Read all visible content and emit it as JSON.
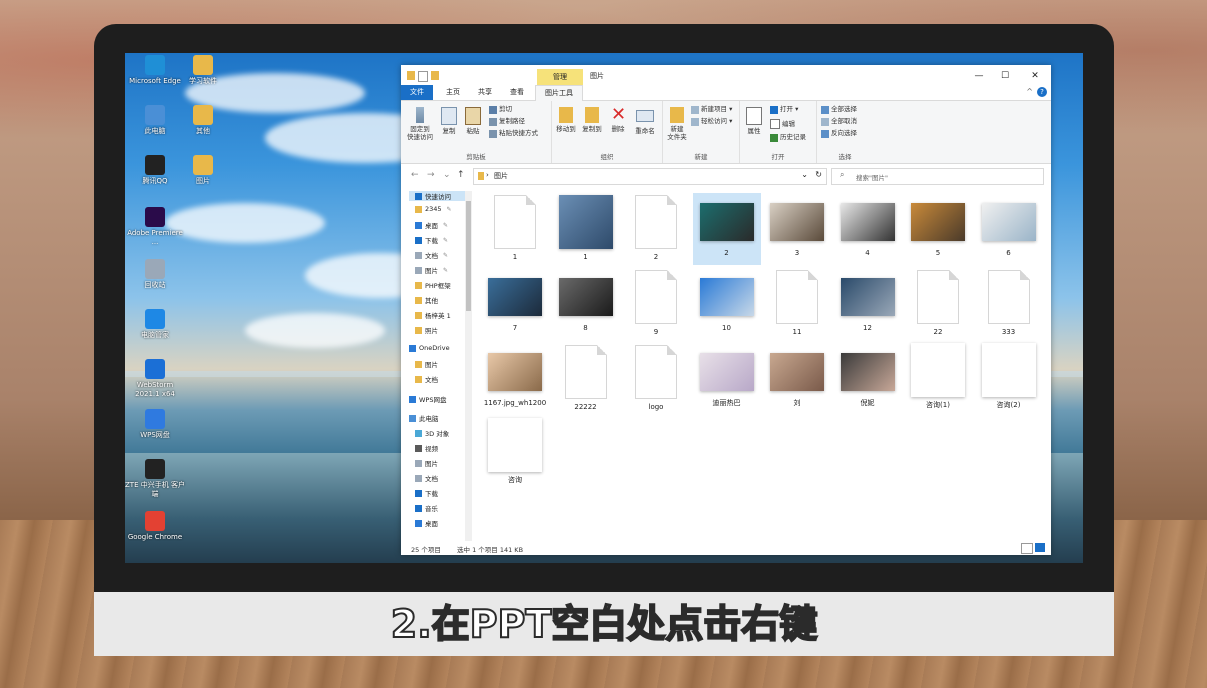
{
  "desktop": {
    "icons": [
      {
        "label": "Microsoft Edge",
        "color": "#1f8fd6"
      },
      {
        "label": "学习软件",
        "color": "#e8b84a"
      },
      {
        "label": "此电脑",
        "color": "#4a8fd6"
      },
      {
        "label": "其他",
        "color": "#e8b84a"
      },
      {
        "label": "腾讯QQ",
        "color": "#222222"
      },
      {
        "label": "图片",
        "color": "#e8b84a"
      },
      {
        "label": "Adobe Premiere ...",
        "color": "#2a0b4a"
      },
      {
        "label": "回收站",
        "color": "#9aa8b8"
      },
      {
        "label": "电脑管家",
        "color": "#1e88e5"
      },
      {
        "label": "WebStorm 2021.1 x64",
        "color": "#1b6fd6"
      },
      {
        "label": "WPS网盘",
        "color": "#2f7ae0"
      },
      {
        "label": "ZTE 中兴手机 客户端",
        "color": "#222222"
      },
      {
        "label": "Google Chrome",
        "color": "#e34133"
      }
    ]
  },
  "window": {
    "title": "图片",
    "context_tab": "管理",
    "controls": {
      "minimize": "—",
      "maximize": "☐",
      "close": "✕"
    },
    "tabs": [
      "文件",
      "主页",
      "共享",
      "查看",
      "图片工具"
    ],
    "help": "?",
    "collapse": "^"
  },
  "ribbon": {
    "clipboard": {
      "label": "剪贴板",
      "pin": "固定到\n快速访问",
      "copy": "复制",
      "paste": "粘贴",
      "cut": "剪切",
      "copy_path": "复制路径",
      "paste_shortcut": "粘贴快捷方式"
    },
    "organize": {
      "label": "组织",
      "move_to": "移动到",
      "copy_to": "复制到",
      "delete": "删除",
      "rename": "重命名"
    },
    "new": {
      "label": "新建",
      "new_folder": "新建\n文件夹",
      "new_item": "新建项目 ▾",
      "easy_access": "轻松访问 ▾"
    },
    "open": {
      "label": "打开",
      "properties": "属性",
      "open": "打开 ▾",
      "edit": "编辑",
      "history": "历史记录"
    },
    "select": {
      "label": "选择",
      "select_all": "全部选择",
      "select_none": "全部取消",
      "invert": "反向选择"
    }
  },
  "address": {
    "back": "←",
    "forward": "→",
    "recent": "⌄",
    "up": "↑",
    "path_sep": "›",
    "path": "图片",
    "dropdown": "⌄",
    "refresh": "↻",
    "search_placeholder": "搜索\"图片\""
  },
  "nav": [
    {
      "label": "快速访问",
      "sel": true,
      "pin": false
    },
    {
      "label": "2345",
      "sel": false,
      "pin": true
    },
    {
      "label": "桌面",
      "sel": false,
      "pin": true
    },
    {
      "label": "下载",
      "sel": false,
      "pin": true
    },
    {
      "label": "文档",
      "sel": false,
      "pin": true
    },
    {
      "label": "图片",
      "sel": false,
      "pin": true
    },
    {
      "label": "PHP框架",
      "sel": false,
      "pin": false
    },
    {
      "label": "其他",
      "sel": false,
      "pin": false
    },
    {
      "label": "杨梓英 1",
      "sel": false,
      "pin": false
    },
    {
      "label": "照片",
      "sel": false,
      "pin": false
    },
    {
      "label": "OneDrive",
      "sel": false,
      "pin": false
    },
    {
      "label": "图片",
      "sel": false,
      "pin": false
    },
    {
      "label": "文档",
      "sel": false,
      "pin": false
    },
    {
      "label": "WPS网盘",
      "sel": false,
      "pin": false
    },
    {
      "label": "此电脑",
      "sel": false,
      "pin": false
    },
    {
      "label": "3D 对象",
      "sel": false,
      "pin": false
    },
    {
      "label": "视频",
      "sel": false,
      "pin": false
    },
    {
      "label": "图片",
      "sel": false,
      "pin": false
    },
    {
      "label": "文档",
      "sel": false,
      "pin": false
    },
    {
      "label": "下载",
      "sel": false,
      "pin": false
    },
    {
      "label": "音乐",
      "sel": false,
      "pin": false
    },
    {
      "label": "桌面",
      "sel": false,
      "pin": false
    }
  ],
  "nav_pin_glyph": "✎",
  "files": [
    {
      "name": "1",
      "kind": "doc"
    },
    {
      "name": "1",
      "kind": "photo",
      "c1": "#6b8fb5",
      "c2": "#2e4a6a"
    },
    {
      "name": "2",
      "kind": "doc"
    },
    {
      "name": "2",
      "kind": "photo",
      "c1": "#1c6e6e",
      "c2": "#2a2a2a",
      "sel": true
    },
    {
      "name": "3",
      "kind": "photo",
      "c1": "#d9d0c4",
      "c2": "#5a4a3a"
    },
    {
      "name": "4",
      "kind": "photo",
      "c1": "#e8e8e8",
      "c2": "#333333"
    },
    {
      "name": "5",
      "kind": "photo",
      "c1": "#c98a3a",
      "c2": "#4a3a2a"
    },
    {
      "name": "6",
      "kind": "photo",
      "c1": "#f0f0f0",
      "c2": "#9ab4c8"
    },
    {
      "name": "7",
      "kind": "photo",
      "c1": "#3a6e9a",
      "c2": "#1c2a3a"
    },
    {
      "name": "8",
      "kind": "photo",
      "c1": "#6a6a6a",
      "c2": "#1a1a1a"
    },
    {
      "name": "9",
      "kind": "doc"
    },
    {
      "name": "10",
      "kind": "photo",
      "c1": "#2a7ad6",
      "c2": "#c8d8e8"
    },
    {
      "name": "11",
      "kind": "doc"
    },
    {
      "name": "12",
      "kind": "photo",
      "c1": "#2a4a6a",
      "c2": "#9aa8b8"
    },
    {
      "name": "22",
      "kind": "doc"
    },
    {
      "name": "333",
      "kind": "doc"
    },
    {
      "name": "1167.jpg_wh1200",
      "kind": "photo",
      "c1": "#e8c8a8",
      "c2": "#8a6a4a"
    },
    {
      "name": "22222",
      "kind": "doc"
    },
    {
      "name": "logo",
      "kind": "doc"
    },
    {
      "name": "迪丽热巴",
      "kind": "photo",
      "c1": "#e8e0e8",
      "c2": "#b8a8c8"
    },
    {
      "name": "刘",
      "kind": "photo",
      "c1": "#c8a890",
      "c2": "#7a5a4a"
    },
    {
      "name": "倪妮",
      "kind": "photo",
      "c1": "#3a3a3a",
      "c2": "#c8a898"
    },
    {
      "name": "咨询(1)",
      "kind": "blank"
    },
    {
      "name": "咨询(2)",
      "kind": "blank"
    },
    {
      "name": "咨询",
      "kind": "blank"
    }
  ],
  "status": {
    "count": "25 个项目",
    "selected": "选中 1 个项目 141 KB"
  },
  "caption": "2.在PPT空白处点击右键"
}
